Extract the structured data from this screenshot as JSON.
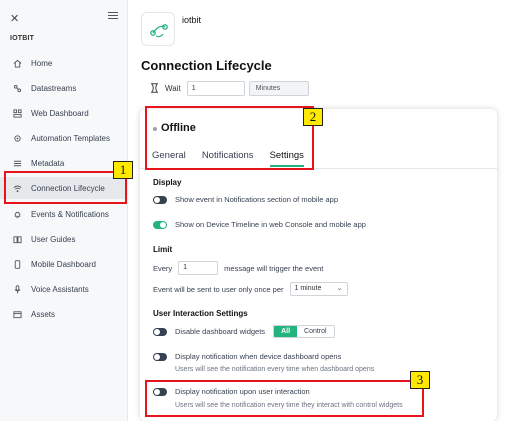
{
  "sidebar": {
    "close_glyph": "✕",
    "brand": "IOTBIT",
    "items": [
      {
        "label": "Home",
        "icon": "home-icon"
      },
      {
        "label": "Datastreams",
        "icon": "datastreams-icon"
      },
      {
        "label": "Web Dashboard",
        "icon": "web-dashboard-icon"
      },
      {
        "label": "Automation Templates",
        "icon": "automation-icon"
      },
      {
        "label": "Metadata",
        "icon": "metadata-icon"
      },
      {
        "label": "Connection Lifecycle",
        "icon": "wifi-icon"
      },
      {
        "label": "Events & Notifications",
        "icon": "bell-icon"
      },
      {
        "label": "User Guides",
        "icon": "book-icon"
      },
      {
        "label": "Mobile Dashboard",
        "icon": "mobile-icon"
      },
      {
        "label": "Voice Assistants",
        "icon": "microphone-icon"
      },
      {
        "label": "Assets",
        "icon": "assets-icon"
      }
    ]
  },
  "header": {
    "device_name": "iotbit",
    "page_title": "Connection Lifecycle",
    "wait_label": "Wait",
    "wait_value": "1",
    "wait_unit": "Minutes"
  },
  "panel": {
    "status": "Offline",
    "tabs": [
      "General",
      "Notifications",
      "Settings"
    ],
    "display": {
      "heading": "Display",
      "opt1": "Show event in Notifications section of mobile app",
      "opt2": "Show on Device Timeline in web Console and mobile app"
    },
    "limit": {
      "heading": "Limit",
      "every": "Every",
      "value": "1",
      "suffix": "message will trigger the event",
      "once_label": "Event will be sent to user only once per",
      "once_value": "1 minute"
    },
    "interaction": {
      "heading": "User Interaction Settings",
      "disable_widgets": "Disable dashboard widgets",
      "seg_all": "All",
      "seg_control": "Control",
      "notif_opens": "Display notification when device dashboard opens",
      "notif_opens_hint": "Users will see the notification every time when dashboard opens",
      "notif_interaction": "Display notification upon user interaction",
      "notif_interaction_hint": "Users will see the notification every time they interact with control widgets"
    }
  },
  "callouts": [
    "1",
    "2",
    "3"
  ],
  "colors": {
    "accent": "#23b37d",
    "highlight": "#e8141b",
    "badge": "#ffe900"
  }
}
